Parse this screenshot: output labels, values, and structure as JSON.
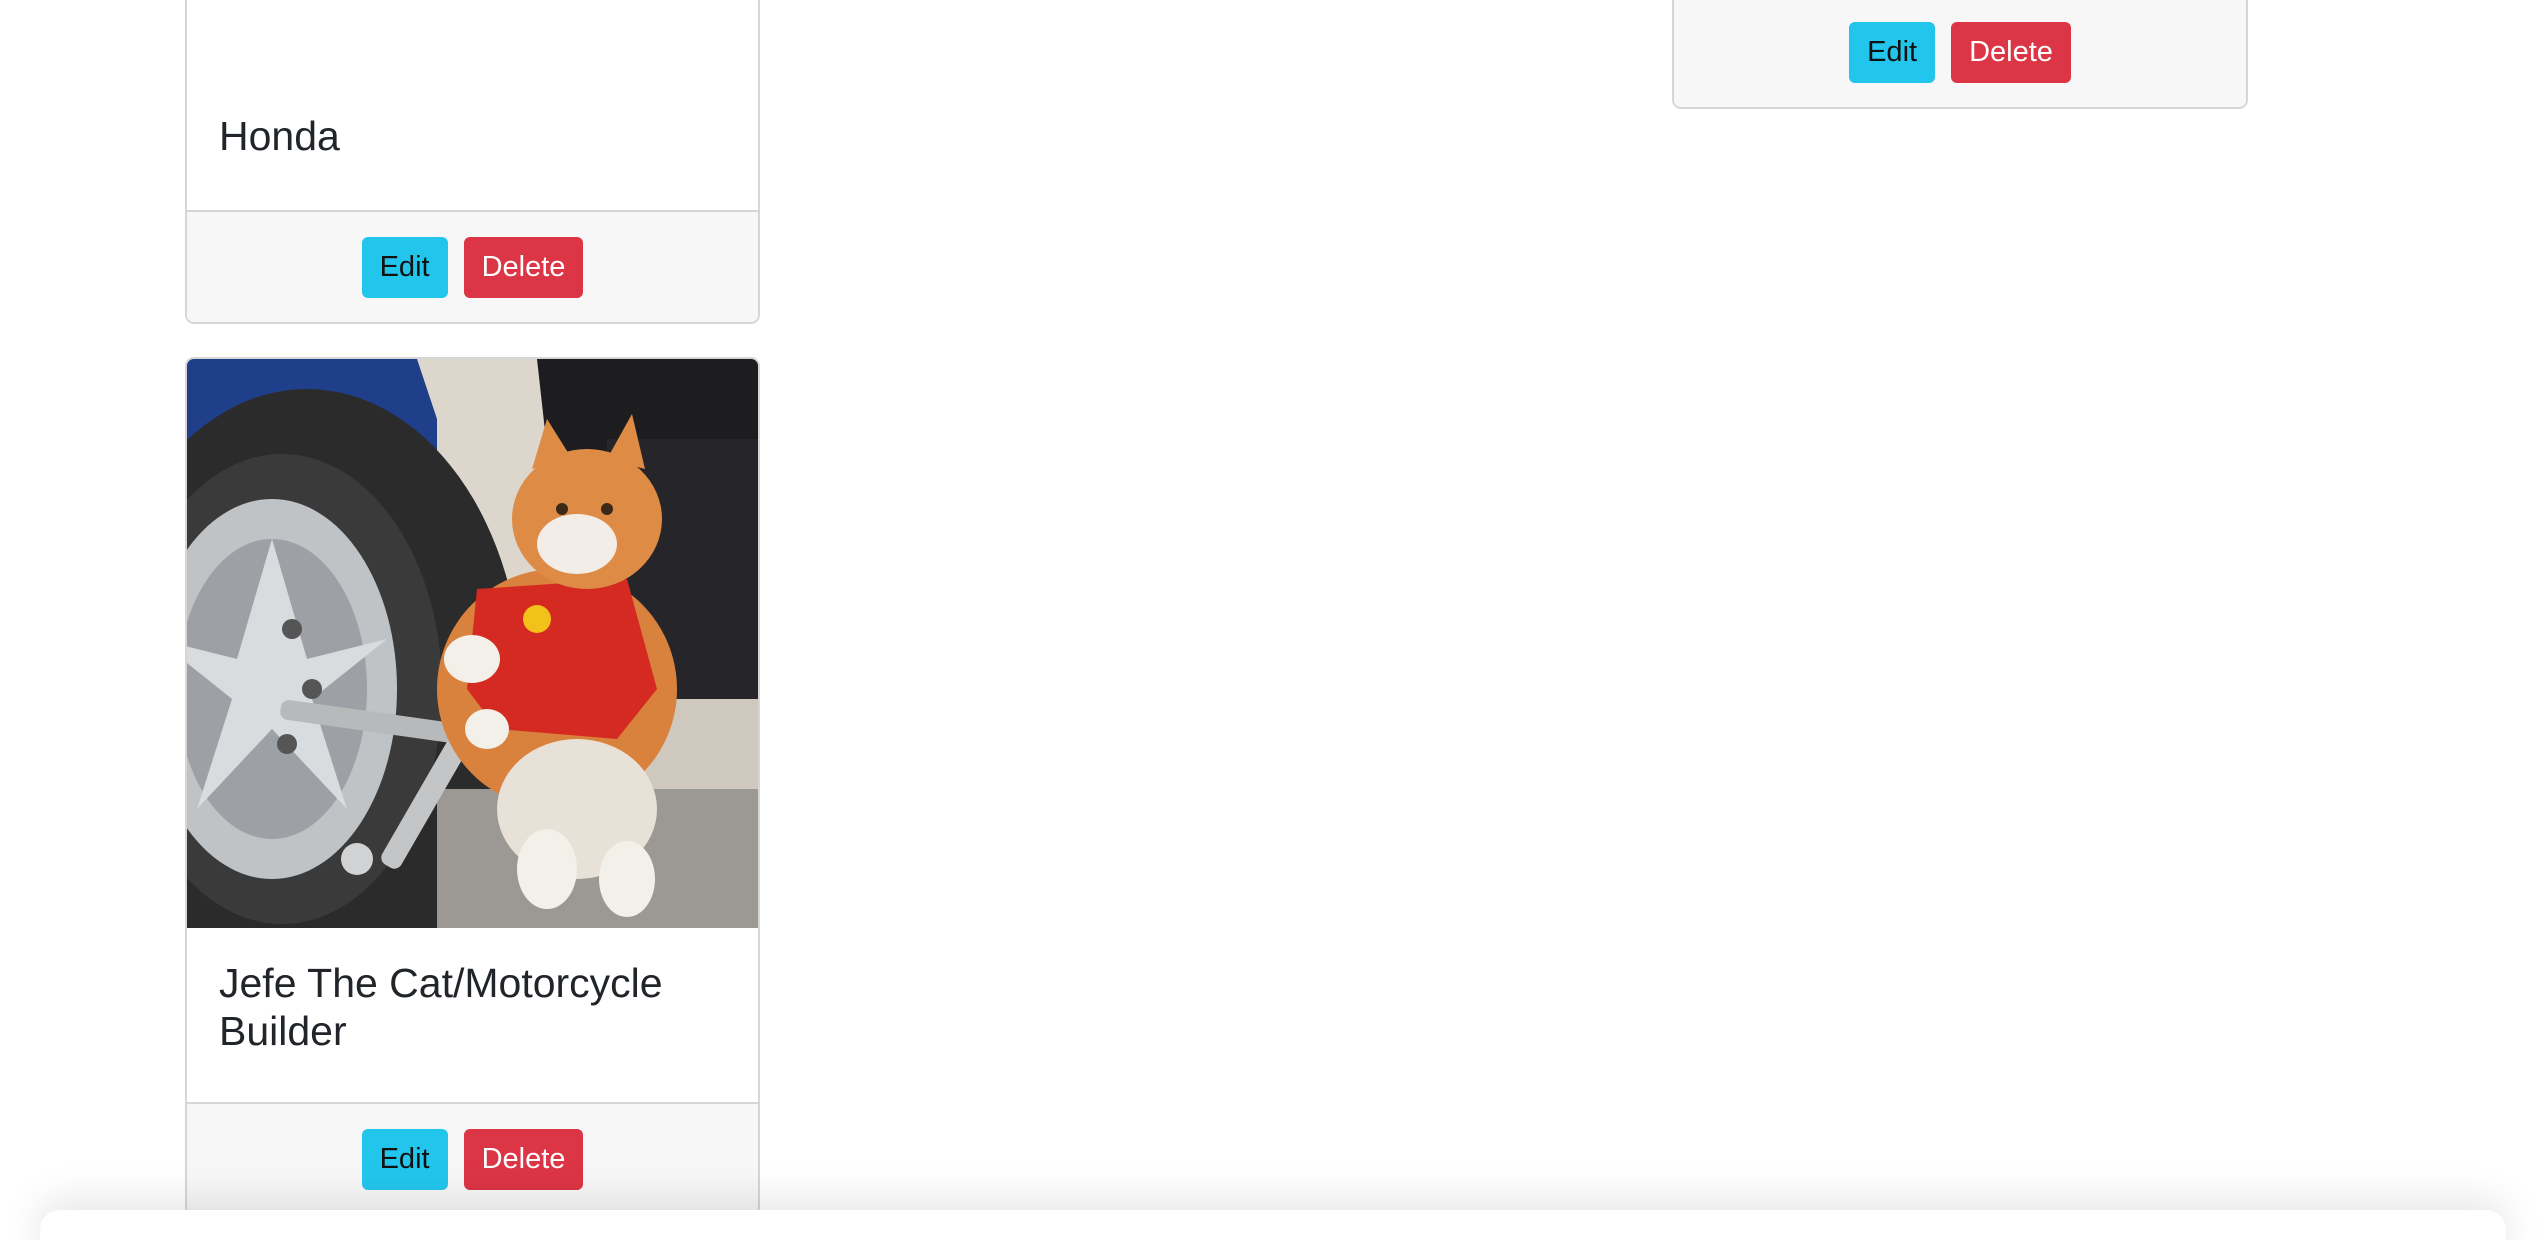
{
  "cards": [
    {
      "title": "Honda",
      "edit_label": "Edit",
      "delete_label": "Delete"
    },
    {
      "title": "",
      "edit_label": "Edit",
      "delete_label": "Delete"
    },
    {
      "title": "Jefe The Cat/Motorcycle Builder",
      "edit_label": "Edit",
      "delete_label": "Delete",
      "image_icon": "cat-mechanic-image"
    }
  ],
  "colors": {
    "edit_button": "#22c6ec",
    "delete_button": "#dc3545",
    "card_border": "#d6d6d6",
    "footer_bg": "#f7f7f7",
    "title_text": "#212529"
  }
}
